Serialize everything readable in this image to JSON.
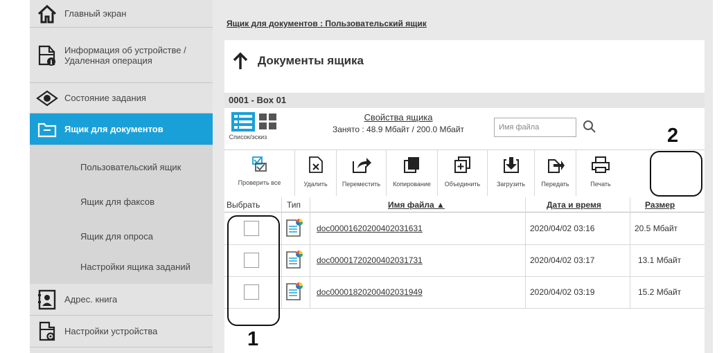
{
  "sidebar": {
    "items": [
      {
        "label": "Главный экран",
        "icon": "home-icon"
      },
      {
        "label": "Информация об устройстве / Удаленная операция",
        "icon": "device-info-icon"
      },
      {
        "label": "Состояние задания",
        "icon": "eye-icon"
      },
      {
        "label": "Ящик для документов",
        "icon": "folder-icon",
        "active": true
      },
      {
        "label": "Адрес. книга",
        "icon": "address-book-icon"
      },
      {
        "label": "Настройки устройства",
        "icon": "device-settings-icon"
      }
    ],
    "subitems": [
      {
        "label": "Пользовательский ящик"
      },
      {
        "label": "Ящик для факсов"
      },
      {
        "label": "Ящик для опроса"
      },
      {
        "label": "Настройки ящика заданий"
      }
    ]
  },
  "breadcrumb": "Ящик для документов : Пользовательский ящик",
  "page": {
    "title": "Документы ящика",
    "box_name": "0001 - Box 01",
    "view_label": "Список/эскиз",
    "box_props_link": "Свойства ящика",
    "usage": "Занято : 48.9 Мбайт / 200.0 Мбайт",
    "search_placeholder": "Имя файла"
  },
  "toolbar": [
    {
      "label": "Проверить все",
      "icon": "check-all-icon"
    },
    {
      "label": "Удалить",
      "icon": "delete-icon"
    },
    {
      "label": "Переместить",
      "icon": "move-icon"
    },
    {
      "label": "Копирование",
      "icon": "copy-icon"
    },
    {
      "label": "Объединить",
      "icon": "merge-icon"
    },
    {
      "label": "Загрузить",
      "icon": "download-icon"
    },
    {
      "label": "Передать",
      "icon": "send-icon"
    },
    {
      "label": "Печать",
      "icon": "print-icon"
    }
  ],
  "table": {
    "headers": {
      "select": "Выбрать",
      "type": "Тип",
      "name": "Имя файла ▲",
      "date": "Дата и время",
      "size": "Размер"
    },
    "rows": [
      {
        "name": "doc00001620200402031631",
        "date": "2020/04/02 03:16",
        "size": "20.5 Мбайт"
      },
      {
        "name": "doc00001720200402031731",
        "date": "2020/04/02 03:17",
        "size": "13.1 Мбайт"
      },
      {
        "name": "doc00001820200402031949",
        "date": "2020/04/02 03:19",
        "size": "15.2 Мбайт"
      }
    ]
  },
  "callouts": {
    "one": "1",
    "two": "2"
  },
  "colors": {
    "accent": "#1aa0d8",
    "sidebar_bg": "#d6d6d6",
    "main_bg": "#e9e9e9"
  }
}
